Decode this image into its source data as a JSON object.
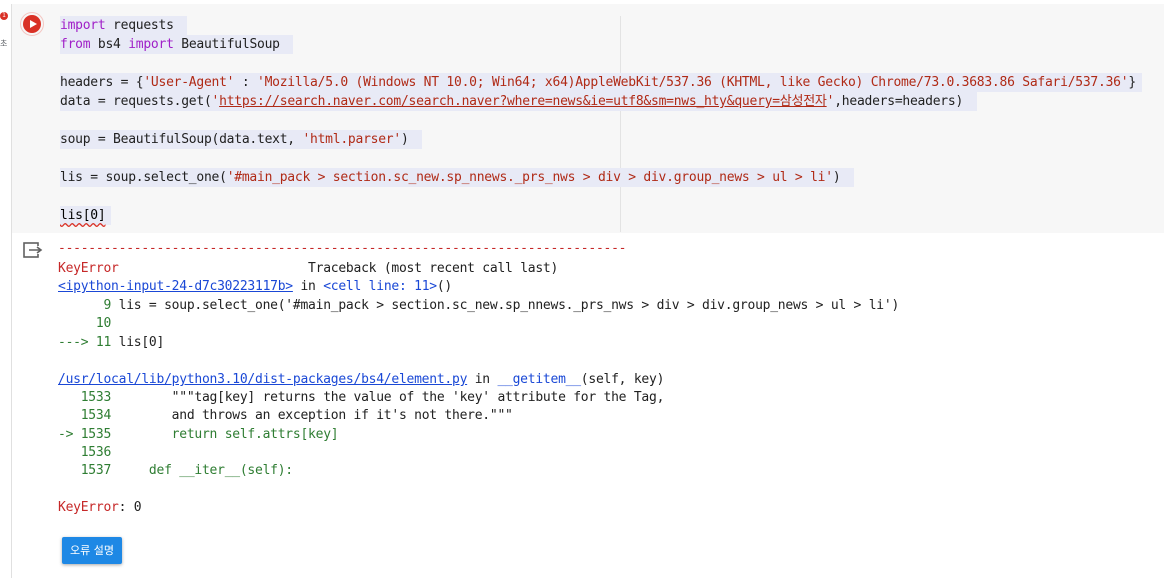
{
  "gutter": {
    "exec_badge": "1",
    "exec_sub": "초"
  },
  "cell": {
    "code_lines": [
      {
        "parts": [
          [
            "kw",
            "import"
          ],
          [
            "plain",
            " requests "
          ]
        ]
      },
      {
        "parts": [
          [
            "kw",
            "from"
          ],
          [
            "plain",
            " bs4 "
          ],
          [
            "kw",
            "import"
          ],
          [
            "plain",
            " BeautifulSoup "
          ]
        ]
      },
      {
        "parts": []
      },
      {
        "parts": [
          [
            "plain",
            "headers = {"
          ],
          [
            "str",
            "'User-Agent'"
          ],
          [
            "plain",
            " : "
          ],
          [
            "str",
            "'Mozilla/5.0 (Windows NT 10.0; Win64; x64)AppleWebKit/537.36 (KHTML, like Gecko) Chrome/73.0.3683.86 Safari/537.36'"
          ],
          [
            "plain",
            "}"
          ]
        ]
      },
      {
        "parts": [
          [
            "plain",
            "data = requests.get("
          ],
          [
            "str",
            "'"
          ],
          [
            "url",
            "https://search.naver.com/search.naver?where=news&ie=utf8&sm=nws_hty&query=삼성전자"
          ],
          [
            "str",
            "'"
          ],
          [
            "plain",
            ",headers=headers) "
          ]
        ]
      },
      {
        "parts": []
      },
      {
        "parts": [
          [
            "plain",
            "soup = BeautifulSoup(data.text, "
          ],
          [
            "str",
            "'html.parser'"
          ],
          [
            "plain",
            ") "
          ]
        ]
      },
      {
        "parts": []
      },
      {
        "parts": [
          [
            "plain",
            "lis = soup.select_one("
          ],
          [
            "str",
            "'#main_pack > section.sc_new.sp_nnews._prs_nws > div > div.group_news > ul > li'"
          ],
          [
            "plain",
            ") "
          ]
        ]
      },
      {
        "parts": []
      },
      {
        "parts": [
          [
            "squig",
            "lis[0]"
          ]
        ]
      }
    ]
  },
  "output": {
    "dashes": "---------------------------------------------------------------------------",
    "error_name": "KeyError",
    "traceback_header": "Traceback (most recent call last)",
    "input_link": "<ipython-input-24-d7c30223117b>",
    "in_text": " in ",
    "cell_line": "<cell line: 11>",
    "cell_line_suffix": "()",
    "ctx1_num": "      9 ",
    "ctx1_code": "lis = soup.select_one('#main_pack > section.sc_new.sp_nnews._prs_nws > div > div.group_news > ul > li')",
    "ctx2_num": "     10",
    "ctx3_arrow": "---> 11 ",
    "ctx3_code": "lis[0]",
    "file_link": "/usr/local/lib/python3.10/dist-packages/bs4/element.py",
    "file_in": " in ",
    "func_name": "__getitem__",
    "func_args": "(self, key)",
    "f1_num": "   1533",
    "f1_code": "        \"\"\"tag[key] returns the value of the 'key' attribute for the Tag,",
    "f2_num": "   1534",
    "f2_code": "        and throws an exception if it's not there.\"\"\"",
    "f3_arrow": "-> 1535",
    "f3_code": "        return self.attrs[key]",
    "f4_num": "   1536",
    "f5_num": "   1537",
    "f5_code": "     def __iter__(self):",
    "final_error": "KeyError",
    "final_msg": ": 0",
    "explain_button": "오류 설명"
  }
}
